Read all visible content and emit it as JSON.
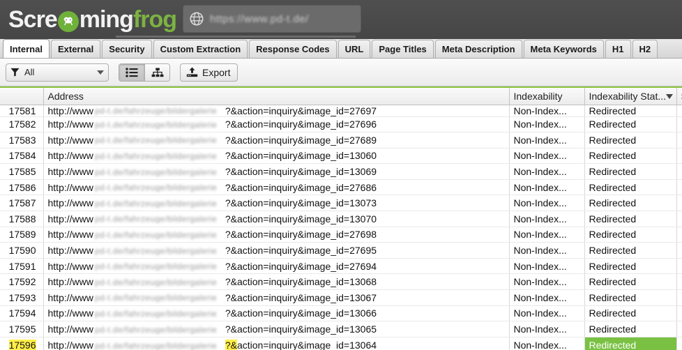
{
  "app": {
    "brand_part1": "Scre",
    "brand_part2": "ming",
    "brand_part3": "frog",
    "logo_icon": "frog-in-circle-icon",
    "accent_green": "#7cb342",
    "titlebar_color": "#4a4a4a"
  },
  "urlbar": {
    "icon": "globe-icon",
    "value": "https://www.pd-t.de/",
    "redacted": true
  },
  "tabs": [
    {
      "label": "Internal",
      "active": true
    },
    {
      "label": "External",
      "active": false
    },
    {
      "label": "Security",
      "active": false
    },
    {
      "label": "Custom Extraction",
      "active": false
    },
    {
      "label": "Response Codes",
      "active": false
    },
    {
      "label": "URL",
      "active": false
    },
    {
      "label": "Page Titles",
      "active": false
    },
    {
      "label": "Meta Description",
      "active": false
    },
    {
      "label": "Meta Keywords",
      "active": false
    },
    {
      "label": "H1",
      "active": false
    },
    {
      "label": "H2",
      "active": false
    }
  ],
  "toolbar": {
    "filter_icon": "funnel-icon",
    "filter_value": "All",
    "list_view_icon": "list-view-icon",
    "tree_view_icon": "tree-view-icon",
    "list_view_selected": true,
    "export_icon": "export-upload-icon",
    "export_label": "Export"
  },
  "table": {
    "columns": [
      {
        "key": "num",
        "label": "",
        "sorted": false
      },
      {
        "key": "address",
        "label": "Address",
        "sorted": false
      },
      {
        "key": "indexability",
        "label": "Indexability",
        "sorted": false
      },
      {
        "key": "indexability_status",
        "label": "Indexability Stat...",
        "sorted": true,
        "sort_dir": "desc"
      },
      {
        "key": "extra",
        "label": "S",
        "sorted": false
      }
    ],
    "address_prefix": "http://www",
    "address_redacted_text": "pd-t.de/fahrzeuge/bildergalerie",
    "rows": [
      {
        "num": "17581",
        "query": "?&action=inquiry&image_id=27697",
        "indexability": "Non-Index...",
        "status": "Redirected",
        "highlight_row": false,
        "highlight_status": false,
        "clipped": true
      },
      {
        "num": "17582",
        "query": "?&action=inquiry&image_id=27696",
        "indexability": "Non-Index...",
        "status": "Redirected",
        "highlight_row": false,
        "highlight_status": false
      },
      {
        "num": "17583",
        "query": "?&action=inquiry&image_id=27689",
        "indexability": "Non-Index...",
        "status": "Redirected",
        "highlight_row": false,
        "highlight_status": false
      },
      {
        "num": "17584",
        "query": "?&action=inquiry&image_id=13060",
        "indexability": "Non-Index...",
        "status": "Redirected",
        "highlight_row": false,
        "highlight_status": false
      },
      {
        "num": "17585",
        "query": "?&action=inquiry&image_id=13069",
        "indexability": "Non-Index...",
        "status": "Redirected",
        "highlight_row": false,
        "highlight_status": false
      },
      {
        "num": "17586",
        "query": "?&action=inquiry&image_id=27686",
        "indexability": "Non-Index...",
        "status": "Redirected",
        "highlight_row": false,
        "highlight_status": false
      },
      {
        "num": "17587",
        "query": "?&action=inquiry&image_id=13073",
        "indexability": "Non-Index...",
        "status": "Redirected",
        "highlight_row": false,
        "highlight_status": false
      },
      {
        "num": "17588",
        "query": "?&action=inquiry&image_id=13070",
        "indexability": "Non-Index...",
        "status": "Redirected",
        "highlight_row": false,
        "highlight_status": false
      },
      {
        "num": "17589",
        "query": "?&action=inquiry&image_id=27698",
        "indexability": "Non-Index...",
        "status": "Redirected",
        "highlight_row": false,
        "highlight_status": false
      },
      {
        "num": "17590",
        "query": "?&action=inquiry&image_id=27695",
        "indexability": "Non-Index...",
        "status": "Redirected",
        "highlight_row": false,
        "highlight_status": false
      },
      {
        "num": "17591",
        "query": "?&action=inquiry&image_id=27694",
        "indexability": "Non-Index...",
        "status": "Redirected",
        "highlight_row": false,
        "highlight_status": false
      },
      {
        "num": "17592",
        "query": "?&action=inquiry&image_id=13068",
        "indexability": "Non-Index...",
        "status": "Redirected",
        "highlight_row": false,
        "highlight_status": false
      },
      {
        "num": "17593",
        "query": "?&action=inquiry&image_id=13067",
        "indexability": "Non-Index...",
        "status": "Redirected",
        "highlight_row": false,
        "highlight_status": false
      },
      {
        "num": "17594",
        "query": "?&action=inquiry&image_id=13066",
        "indexability": "Non-Index...",
        "status": "Redirected",
        "highlight_row": false,
        "highlight_status": false
      },
      {
        "num": "17595",
        "query": "?&action=inquiry&image_id=13065",
        "indexability": "Non-Index...",
        "status": "Redirected",
        "highlight_row": false,
        "highlight_status": false
      },
      {
        "num": "17596",
        "query": "?&action=inquiry&image_id=13064",
        "indexability": "Non-Index...",
        "status": "Redirected",
        "highlight_row": true,
        "highlight_status": true,
        "highlight_query_chars": 2
      }
    ],
    "highlight_color": "#ffef4a",
    "status_highlight_color": "#7ac143",
    "header_rule_color": "#8dc63f"
  }
}
